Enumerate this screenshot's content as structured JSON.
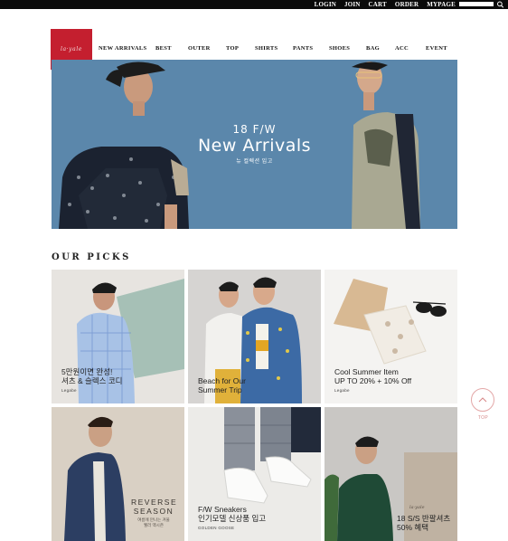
{
  "topbar": {
    "links": [
      "LOGIN",
      "JOIN",
      "CART",
      "ORDER",
      "MYPAGE"
    ]
  },
  "header": {
    "logo_text": "la·yale",
    "nav": [
      "NEW ARRIVALS",
      "BEST",
      "OUTER",
      "TOP",
      "SHIRTS",
      "PANTS",
      "SHOES",
      "BAG",
      "ACC",
      "EVENT"
    ]
  },
  "hero": {
    "season": "18 F/W",
    "headline": "New Arrivals",
    "sub": "뉴 컬렉션 입고"
  },
  "picks": {
    "title": "OUR PICKS",
    "cards": [
      {
        "line1": "5만원이면 완성!",
        "line2": "셔츠 & 슬렉스 코디",
        "brand": "Legabe"
      },
      {
        "line1": "Beach for Our",
        "line2": "Summer Trip",
        "brand": ""
      },
      {
        "line1": "Cool Summer Item",
        "line2": "UP TO 20% + 10% Off",
        "brand": "Legabe"
      },
      {
        "line1": "REVERSE",
        "line2": "SEASON",
        "line3": "여름에 만나는 겨울",
        "line4": "웰러 액시즌",
        "brand": ""
      },
      {
        "line1": "F/W Sneakers",
        "line2": "인기모델 신상품 입고",
        "brand": "GOLDEN GOOSE"
      },
      {
        "line1": "18 S/S 반팔셔츠",
        "line2": "50% 혜택",
        "brand": "la·yale"
      }
    ]
  },
  "top_button": {
    "label": "TOP"
  },
  "colors": {
    "brand_red": "#c41f2f",
    "hero_blue": "#5b87ab",
    "topbar": "#0a0a0a"
  }
}
